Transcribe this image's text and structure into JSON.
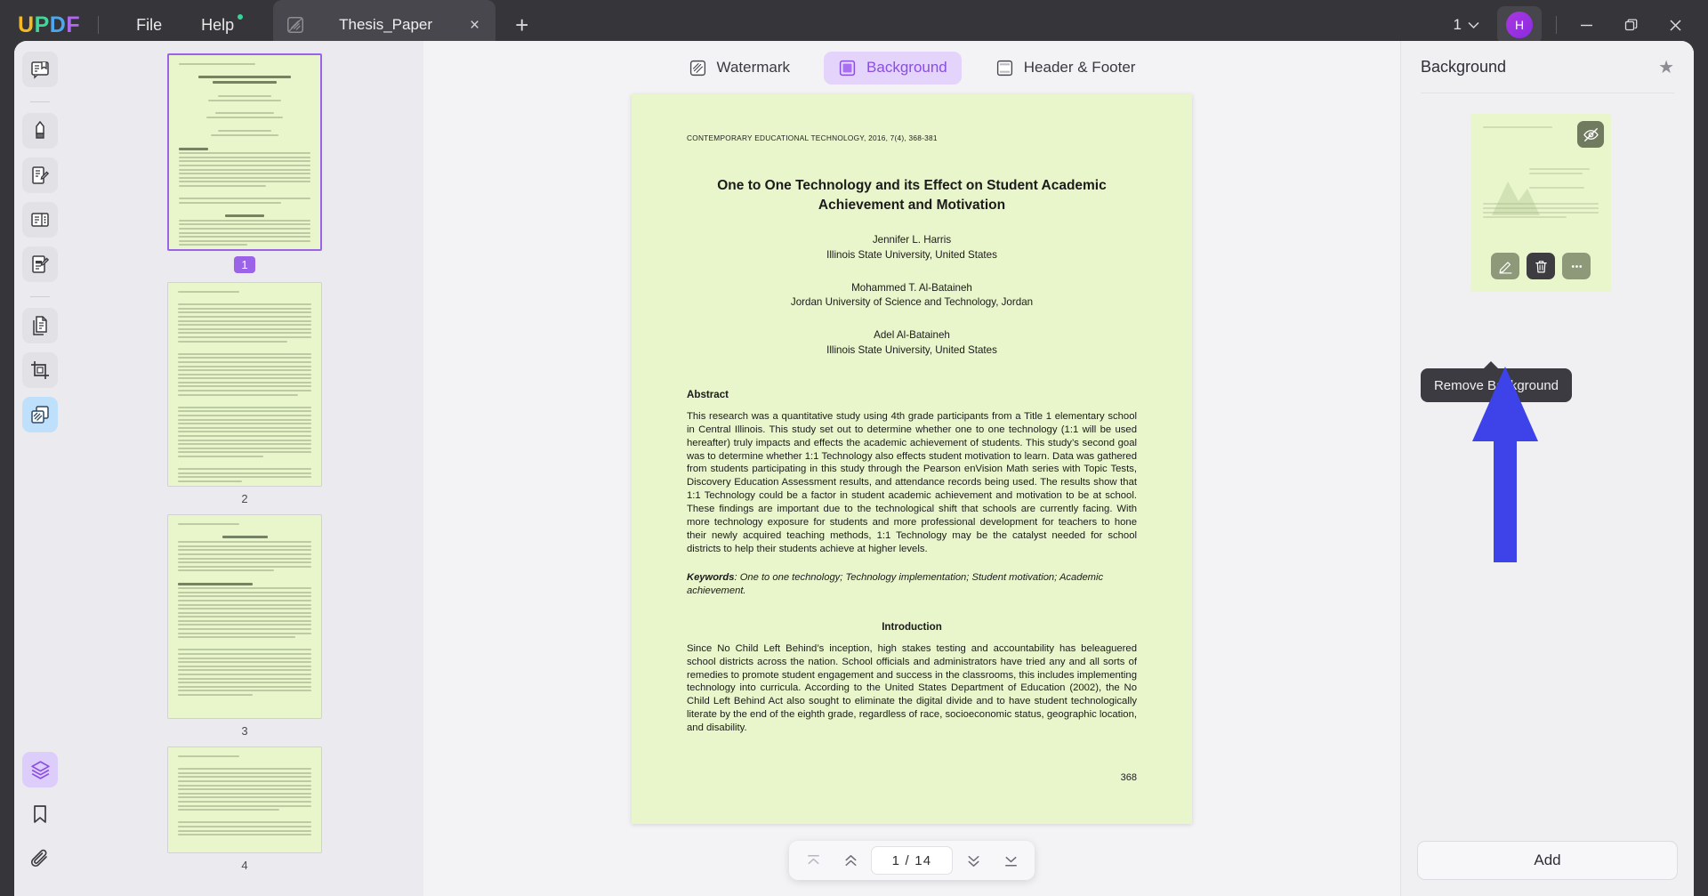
{
  "titlebar": {
    "logo": [
      "U",
      "P",
      "D",
      "F"
    ],
    "menus": [
      {
        "label": "File",
        "dot": false
      },
      {
        "label": "Help",
        "dot": true
      }
    ],
    "tab": {
      "title": "Thesis_Paper",
      "icon": "watermark-icon",
      "close": "×"
    },
    "new_tab": "+",
    "page_selector": "1",
    "avatar_initial": "H",
    "window_controls": [
      "minimize",
      "maximize",
      "close"
    ]
  },
  "rail": {
    "items": [
      {
        "name": "reader-icon",
        "state": "shade"
      },
      {
        "name": "highlighter-icon",
        "state": "shade"
      },
      {
        "name": "edit-pdf-icon",
        "state": "shade"
      },
      {
        "name": "page-organize-icon",
        "state": "shade"
      },
      {
        "name": "form-edit-icon",
        "state": "shade"
      },
      {
        "name": "convert-pdf-icon",
        "state": "shade"
      },
      {
        "name": "crop-page-icon",
        "state": "shade"
      },
      {
        "name": "watermark-background-icon",
        "state": "active-blue"
      }
    ],
    "bottom_items": [
      {
        "name": "layers-icon",
        "state": "active-purple"
      },
      {
        "name": "bookmark-icon",
        "state": "plain"
      },
      {
        "name": "attachment-icon",
        "state": "plain"
      }
    ]
  },
  "thumbnails": [
    {
      "label": "1",
      "selected": true
    },
    {
      "label": "2",
      "selected": false
    },
    {
      "label": "3",
      "selected": false
    },
    {
      "label": "4",
      "selected": false
    }
  ],
  "toolbar_tabs": [
    {
      "label": "Watermark",
      "icon": "watermark-icon",
      "active": false
    },
    {
      "label": "Background",
      "icon": "background-icon",
      "active": true
    },
    {
      "label": "Header & Footer",
      "icon": "header-footer-icon",
      "active": false
    }
  ],
  "document": {
    "journal_line": "CONTEMPORARY EDUCATIONAL TECHNOLOGY, 2016, 7(4), 368-381",
    "title": "One to One Technology and its Effect on Student Academic Achievement and Motivation",
    "authors": [
      {
        "name": "Jennifer L. Harris",
        "affiliation": "Illinois State University, United States"
      },
      {
        "name": "Mohammed T. Al-Bataineh",
        "affiliation": "Jordan University of Science and Technology, Jordan"
      },
      {
        "name": "Adel Al-Bataineh",
        "affiliation": "Illinois State University, United States"
      }
    ],
    "abstract_heading": "Abstract",
    "abstract_body": "This research was a quantitative study using 4th grade participants from a Title 1 elementary school in Central Illinois.  This study set out to determine whether one to one technology (1:1 will be used hereafter) truly impacts and effects the academic achievement of students.  This study’s second goal was to determine whether 1:1 Technology also effects student motivation to learn.  Data was gathered from students participating in this study through the Pearson enVision Math series with Topic Tests, Discovery Education Assessment results, and attendance records being used.  The results show that 1:1 Technology could be a factor in student academic achievement and motivation to be at school.   These findings are important due to the technological shift that schools are currently facing.  With more technology exposure for students and more professional development for teachers to hone their newly acquired teaching methods, 1:1 Technology may be the catalyst needed for school districts to help their students achieve at higher levels.",
    "keywords_label": "Keywords",
    "keywords_value": "One to one technology; Technology implementation; Student motivation; Academic achievement.",
    "intro_heading": "Introduction",
    "intro_body": "Since No Child Left Behind’s inception, high stakes testing and accountability has beleaguered school districts across the nation.  School officials and administrators have tried any and all sorts of remedies to promote student engagement and success in the classrooms, this includes implementing technology into curricula.  According to the United States Department of Education (2002), the No Child Left Behind Act also sought to eliminate the digital divide and to have student technologically literate by the end of the eighth grade, regardless of race, socioeconomic status, geographic location, and disability.",
    "folio": "368"
  },
  "pagenav": {
    "first": "first-page",
    "prev": "previous-page",
    "value": "1 / 14",
    "next": "next-page",
    "last": "last-page"
  },
  "right_panel": {
    "title": "Background",
    "star": "★",
    "card": {
      "visibility_icon": "eye-off-icon",
      "actions": [
        {
          "name": "edit-background-button",
          "icon": "pencil-icon",
          "variant": "olive"
        },
        {
          "name": "remove-background-button",
          "icon": "trash-icon",
          "variant": "dark"
        },
        {
          "name": "more-options-button",
          "icon": "ellipsis-icon",
          "variant": "olive"
        }
      ]
    },
    "tooltip": "Remove Background",
    "add_button": "Add"
  },
  "colors": {
    "accent_purple": "#8a4ee0",
    "titlebar": "#35353a",
    "page_bg_green": "#e9f5cb",
    "cursor_blue": "#3d43e8",
    "tooltip_bg": "#3c3b41"
  }
}
